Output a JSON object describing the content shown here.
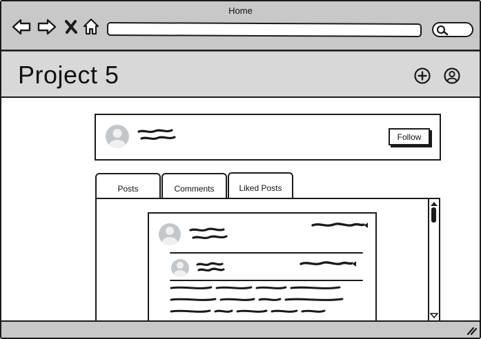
{
  "window": {
    "title": "Home"
  },
  "browser": {
    "back_icon": "arrow-left-icon",
    "forward_icon": "arrow-right-icon",
    "stop_icon": "close-icon",
    "home_icon": "home-icon",
    "url": "",
    "search_icon": "search-icon"
  },
  "header": {
    "title": "Project 5",
    "add_icon": "plus-circle-icon",
    "profile_icon": "user-circle-icon"
  },
  "profile": {
    "avatar_icon": "avatar-icon",
    "follow_label": "Follow"
  },
  "tabs": [
    {
      "label": "Posts"
    },
    {
      "label": "Comments"
    },
    {
      "label": "Liked Posts"
    }
  ],
  "colors": {
    "chrome": "#c8c8c8",
    "header": "#d8d8d8",
    "ink": "#1a1a1a",
    "avatar": "#c4c7ca"
  }
}
